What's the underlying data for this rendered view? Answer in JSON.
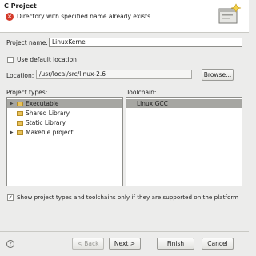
{
  "window": {
    "title": "C Project"
  },
  "header": {
    "error_message": "Directory with specified name already exists."
  },
  "form": {
    "project_name_label": "Project name:",
    "project_name_value": "LinuxKernel",
    "use_default_location_label": "Use default location",
    "use_default_location_checked": false,
    "location_label": "Location:",
    "location_value": "/usr/local/src/linux-2.6",
    "browse_label": "Browse..."
  },
  "project_types": {
    "label": "Project types:",
    "items": [
      {
        "label": "Executable",
        "selected": true,
        "expandable": true
      },
      {
        "label": "Shared Library",
        "selected": false,
        "expandable": false
      },
      {
        "label": "Static Library",
        "selected": false,
        "expandable": false
      },
      {
        "label": "Makefile project",
        "selected": false,
        "expandable": true
      }
    ]
  },
  "toolchain": {
    "label": "Toolchain:",
    "items": [
      {
        "label": "Linux GCC",
        "selected": true
      }
    ]
  },
  "filter": {
    "label": "Show project types and toolchains only if they are supported on the platform",
    "checked": true
  },
  "buttons": {
    "back": "< Back",
    "next": "Next >",
    "finish": "Finish",
    "cancel": "Cancel",
    "help": "?"
  },
  "colors": {
    "selection": "#a6a6a2",
    "error": "#d43a2a",
    "folder": "#e8c25a"
  }
}
